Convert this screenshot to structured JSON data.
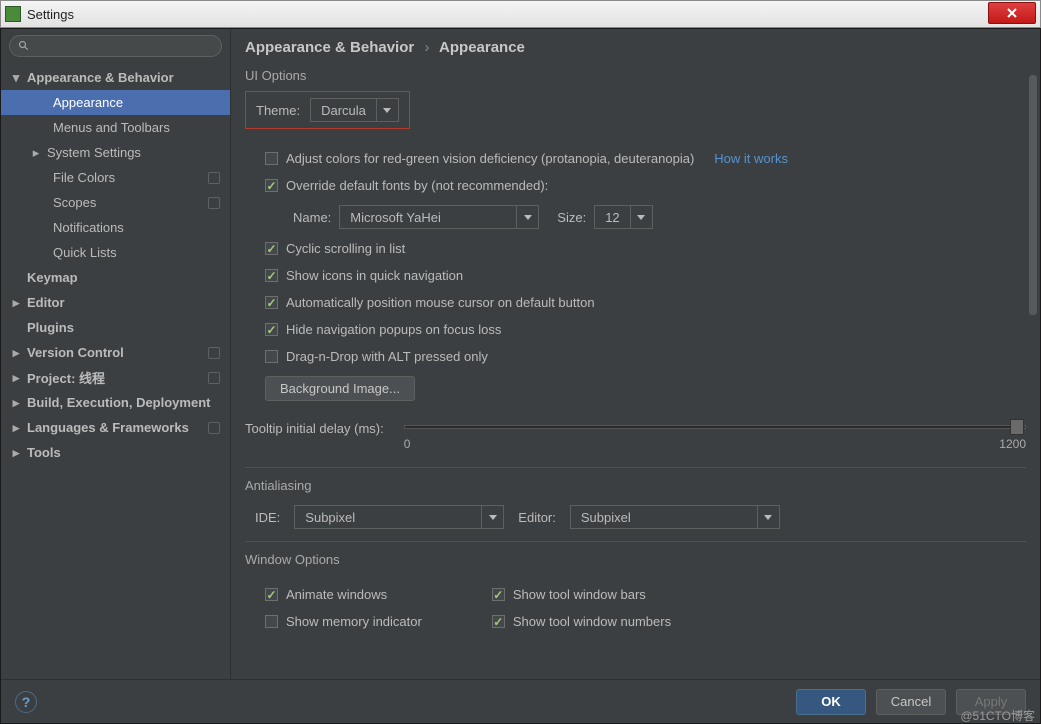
{
  "window": {
    "title": "Settings"
  },
  "sidebar": {
    "items": [
      {
        "label": "Appearance & Behavior",
        "bold": true,
        "arrow": "down",
        "lvl": 0
      },
      {
        "label": "Appearance",
        "lvl": 2,
        "selected": true
      },
      {
        "label": "Menus and Toolbars",
        "lvl": 2
      },
      {
        "label": "System Settings",
        "lvl": 1,
        "arrow": "right"
      },
      {
        "label": "File Colors",
        "lvl": 2,
        "badge": true
      },
      {
        "label": "Scopes",
        "lvl": 2,
        "badge": true
      },
      {
        "label": "Notifications",
        "lvl": 2
      },
      {
        "label": "Quick Lists",
        "lvl": 2
      },
      {
        "label": "Keymap",
        "bold": true,
        "lvl": 0,
        "noarrow": true
      },
      {
        "label": "Editor",
        "bold": true,
        "arrow": "right",
        "lvl": 0
      },
      {
        "label": "Plugins",
        "bold": true,
        "lvl": 0,
        "noarrow": true
      },
      {
        "label": "Version Control",
        "bold": true,
        "arrow": "right",
        "lvl": 0,
        "badge": true
      },
      {
        "label": "Project: 线程",
        "bold": true,
        "arrow": "right",
        "lvl": 0,
        "badge": true
      },
      {
        "label": "Build, Execution, Deployment",
        "bold": true,
        "arrow": "right",
        "lvl": 0
      },
      {
        "label": "Languages & Frameworks",
        "bold": true,
        "arrow": "right",
        "lvl": 0,
        "badge": true
      },
      {
        "label": "Tools",
        "bold": true,
        "arrow": "right",
        "lvl": 0
      }
    ]
  },
  "breadcrumb": {
    "parent": "Appearance & Behavior",
    "current": "Appearance"
  },
  "ui": {
    "section": "UI Options",
    "theme_label": "Theme:",
    "theme_value": "Darcula",
    "adjust_colors": "Adjust colors for red-green vision deficiency (protanopia, deuteranopia)",
    "how_it_works": "How it works",
    "override_fonts": "Override default fonts by (not recommended):",
    "name_label": "Name:",
    "font_value": "Microsoft YaHei",
    "size_label": "Size:",
    "size_value": "12",
    "cyclic": "Cyclic scrolling in list",
    "show_icons": "Show icons in quick navigation",
    "auto_position": "Automatically position mouse cursor on default button",
    "hide_nav": "Hide navigation popups on focus loss",
    "dnd_alt": "Drag-n-Drop with ALT pressed only",
    "bg_image": "Background Image...",
    "tooltip_label": "Tooltip initial delay (ms):",
    "slider_min": "0",
    "slider_max": "1200"
  },
  "aa": {
    "section": "Antialiasing",
    "ide_label": "IDE:",
    "ide_value": "Subpixel",
    "editor_label": "Editor:",
    "editor_value": "Subpixel"
  },
  "wo": {
    "section": "Window Options",
    "animate": "Animate windows",
    "memory": "Show memory indicator",
    "show_bars": "Show tool window bars",
    "show_numbers": "Show tool window numbers"
  },
  "footer": {
    "ok": "OK",
    "cancel": "Cancel",
    "apply": "Apply"
  },
  "watermark": "@51CTO博客"
}
